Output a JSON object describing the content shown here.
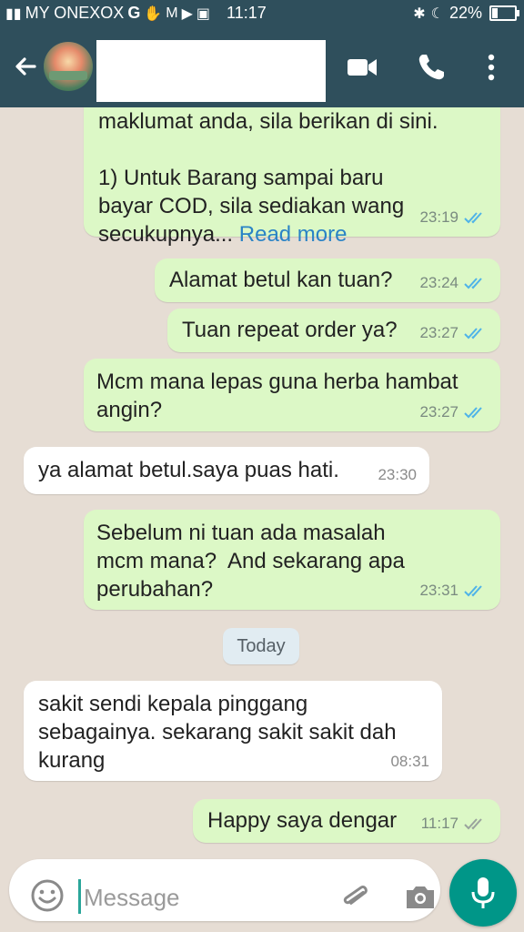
{
  "status_bar": {
    "carrier": "MY ONEXOX",
    "network_glyph": "G",
    "time": "11:17",
    "battery_percent": "22%",
    "battery_level": 0.22
  },
  "header": {
    "back_icon": "arrow-left-icon",
    "video_icon": "video-camera-icon",
    "call_icon": "phone-icon",
    "more_icon": "more-vertical-icon"
  },
  "messages": [
    {
      "dir": "out",
      "text": "maklumat anda, sila berikan di sini.\n\n1) Untuk Barang sampai baru\nbayar COD, sila sediakan wang\nsecukupnya...",
      "link": " Read more",
      "time": "23:19",
      "ticks": "read"
    },
    {
      "dir": "out",
      "text": "Alamat betul kan tuan?",
      "time": "23:24",
      "ticks": "read"
    },
    {
      "dir": "out",
      "text": "Tuan repeat order ya?",
      "time": "23:27",
      "ticks": "read"
    },
    {
      "dir": "out",
      "text": "Mcm mana lepas guna herba hambat\nangin?",
      "time": "23:27",
      "ticks": "read"
    },
    {
      "dir": "in",
      "text": "ya alamat betul.saya puas hati.",
      "time": "23:30"
    },
    {
      "dir": "out",
      "text": "Sebelum ni tuan ada masalah\nmcm mana?  And sekarang apa\nperubahan?",
      "time": "23:31",
      "ticks": "read"
    },
    {
      "dir": "in",
      "text": "sakit sendi kepala pinggang\nsebagainya. sekarang sakit sakit dah\nkurang",
      "time": "08:31"
    },
    {
      "dir": "out",
      "text": "Happy saya dengar",
      "time": "11:17",
      "ticks": "delivered"
    }
  ],
  "date_chip": "Today",
  "composer": {
    "placeholder": "Message",
    "emoji_icon": "emoji-icon",
    "attach_icon": "paperclip-icon",
    "camera_icon": "camera-icon",
    "mic_icon": "microphone-icon"
  },
  "colors": {
    "header": "#2f4f5c",
    "outgoing_bubble": "#dcf8c6",
    "incoming_bubble": "#ffffff",
    "read_ticks": "#4fb3e8",
    "delivered_ticks": "#9aa39d",
    "fab": "#009688",
    "chat_background": "#e6ddd4"
  }
}
